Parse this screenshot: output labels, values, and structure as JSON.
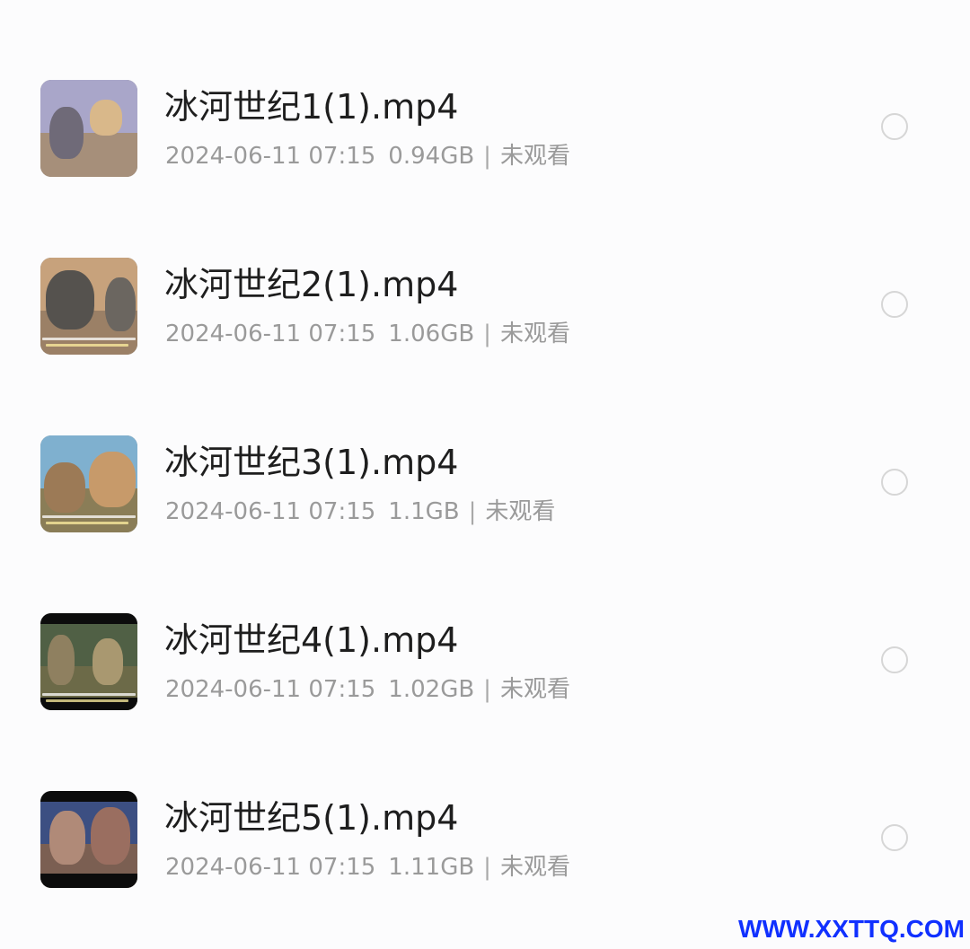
{
  "files": [
    {
      "name": "冰河世纪1(1).mp4",
      "date": "2024-06-11 07:15",
      "size": "0.94GB",
      "status": "未观看",
      "colors": {
        "sky": "#a9a6c9",
        "ground": "#a68f7a",
        "fig1": "#6f6a78",
        "fig2": "#d9b88a"
      }
    },
    {
      "name": "冰河世纪2(1).mp4",
      "date": "2024-06-11 07:15",
      "size": "1.06GB",
      "status": "未观看",
      "colors": {
        "sky": "#c7a27c",
        "ground": "#9b8066",
        "fig1": "#55524e",
        "fig2": "#6b6660"
      }
    },
    {
      "name": "冰河世纪3(1).mp4",
      "date": "2024-06-11 07:15",
      "size": "1.1GB",
      "status": "未观看",
      "colors": {
        "sky": "#7fb0cf",
        "ground": "#8a7d57",
        "fig1": "#9c7a56",
        "fig2": "#c79a6a"
      }
    },
    {
      "name": "冰河世纪4(1).mp4",
      "date": "2024-06-11 07:15",
      "size": "1.02GB",
      "status": "未观看",
      "colors": {
        "sky": "#506045",
        "ground": "#6c6a48",
        "fig1": "#8f8060",
        "fig2": "#a99870"
      }
    },
    {
      "name": "冰河世纪5(1).mp4",
      "date": "2024-06-11 07:15",
      "size": "1.11GB",
      "status": "未观看",
      "colors": {
        "sky": "#3c4f82",
        "ground": "#7b5f52",
        "fig1": "#b08a78",
        "fig2": "#9a6e60"
      }
    }
  ],
  "watermark": "WWW.XXTTQ.COM"
}
